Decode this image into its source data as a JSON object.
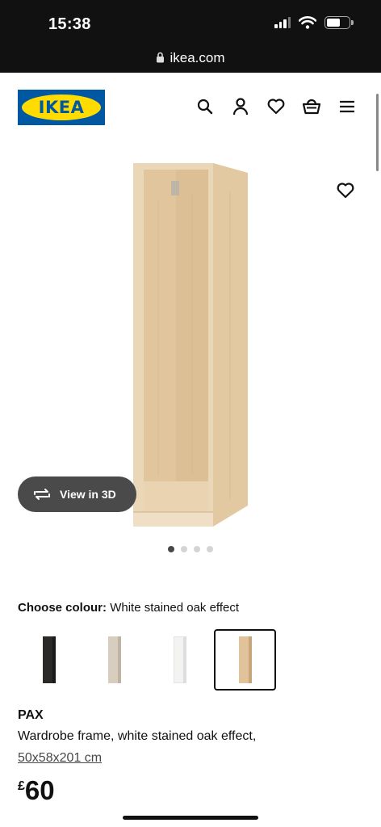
{
  "status_bar": {
    "time": "15:38"
  },
  "browser": {
    "url": "ikea.com"
  },
  "header": {
    "logo_text": "IKEA",
    "icons": [
      "search-icon",
      "account-icon",
      "heart-icon",
      "basket-icon",
      "menu-icon"
    ]
  },
  "gallery": {
    "view_3d_label": "View in 3D",
    "image_count": 4,
    "active_index": 0
  },
  "colour": {
    "heading": "Choose colour:",
    "selected": "White stained oak effect",
    "options": [
      {
        "name": "black-brown",
        "color": "#2b2a28"
      },
      {
        "name": "grey-beige",
        "color": "#cfc6b7"
      },
      {
        "name": "white",
        "color": "#f3f3f1"
      },
      {
        "name": "white stained oak effect",
        "color": "#d9b992",
        "selected": true
      }
    ]
  },
  "product": {
    "name": "PAX",
    "description": "Wardrobe frame, white stained oak effect,",
    "size": "50x58x201 cm",
    "currency": "£",
    "price": "60"
  },
  "colors": {
    "ikea_blue": "#0058a3",
    "ikea_yellow": "#ffdb00",
    "wood": "#e5cfae"
  }
}
